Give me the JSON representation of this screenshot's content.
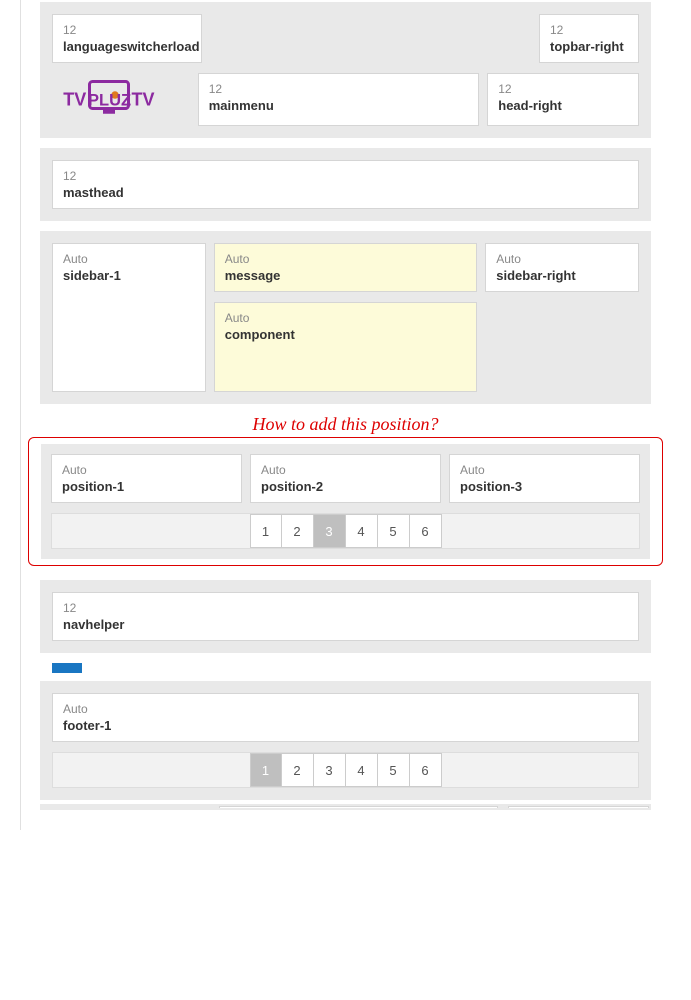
{
  "annotation": "How to add this position?",
  "topbar": {
    "left": {
      "width": "12",
      "name": "languageswitcherload"
    },
    "right": {
      "width": "12",
      "name": "topbar-right"
    }
  },
  "header": {
    "mainmenu": {
      "width": "12",
      "name": "mainmenu"
    },
    "headright": {
      "width": "12",
      "name": "head-right"
    }
  },
  "masthead": {
    "width": "12",
    "name": "masthead"
  },
  "content": {
    "sidebar1": {
      "width": "Auto",
      "name": "sidebar-1"
    },
    "message": {
      "width": "Auto",
      "name": "message"
    },
    "component": {
      "width": "Auto",
      "name": "component"
    },
    "sidebarRight": {
      "width": "Auto",
      "name": "sidebar-right"
    }
  },
  "positions": {
    "p1": {
      "width": "Auto",
      "name": "position-1"
    },
    "p2": {
      "width": "Auto",
      "name": "position-2"
    },
    "p3": {
      "width": "Auto",
      "name": "position-3"
    },
    "pages": [
      "1",
      "2",
      "3",
      "4",
      "5",
      "6"
    ],
    "activePage": "3"
  },
  "navhelper": {
    "width": "12",
    "name": "navhelper"
  },
  "footer": {
    "f1": {
      "width": "Auto",
      "name": "footer-1"
    },
    "pages": [
      "1",
      "2",
      "3",
      "4",
      "5",
      "6"
    ],
    "activePage": "1"
  }
}
